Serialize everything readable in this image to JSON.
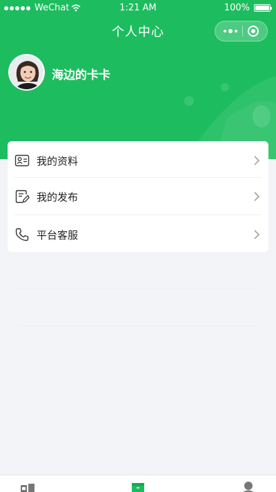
{
  "status_bar": {
    "carrier": "WeChat",
    "time": "1:21 AM",
    "battery": "100%"
  },
  "nav": {
    "title": "个人中心"
  },
  "profile": {
    "username": "海边的卡卡"
  },
  "menu": [
    {
      "label": "我的资料",
      "icon": "profile-card-icon"
    },
    {
      "label": "我的发布",
      "icon": "edit-document-icon"
    },
    {
      "label": "平台客服",
      "icon": "phone-icon"
    }
  ],
  "tabbar": {
    "icons": [
      "shop-icon",
      "box-icon",
      "user-icon"
    ]
  },
  "colors": {
    "brand": "#1dbd5f",
    "background": "#f3f4f8"
  }
}
